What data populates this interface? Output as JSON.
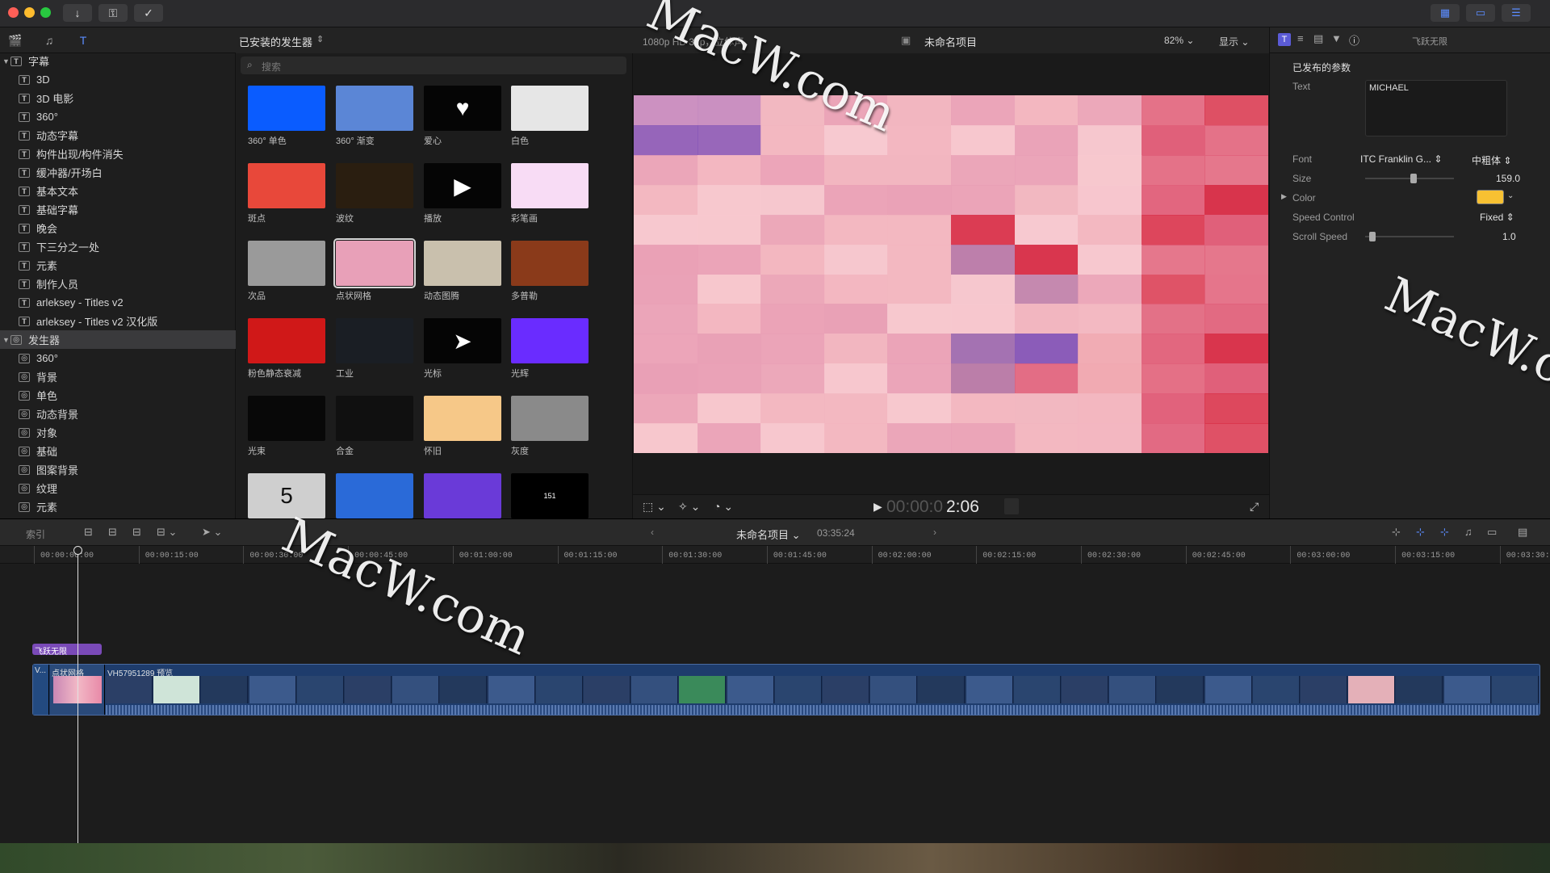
{
  "toolbar": {
    "left_buttons": [
      "download-icon",
      "key-icon",
      "check-circle-icon"
    ],
    "right_buttons": [
      "grid-view-icon",
      "filmstrip-icon",
      "sliders-icon"
    ]
  },
  "sidebar": {
    "sections": [
      {
        "label": "字幕",
        "items": [
          "3D",
          "3D 电影",
          "360°",
          "动态字幕",
          "构件出现/构件消失",
          "缓冲器/开场白",
          "基本文本",
          "基础字幕",
          "晚会",
          "下三分之一处",
          "元素",
          "制作人员",
          "arleksey - Titles v2",
          "arleksey - Titles v2 汉化版"
        ]
      },
      {
        "label": "发生器",
        "items": [
          "360°",
          "背景",
          "单色",
          "动态背景",
          "对象",
          "基础",
          "图案背景",
          "纹理",
          "元素"
        ]
      }
    ]
  },
  "browser": {
    "title": "已安装的发生器",
    "search_placeholder": "搜索",
    "tiles": [
      {
        "label": "360° 单色",
        "color": "#0a5cff"
      },
      {
        "label": "360° 渐变",
        "color": "#5b86d6"
      },
      {
        "label": "爱心",
        "color": "#050505",
        "glyph": "♥"
      },
      {
        "label": "白色",
        "color": "#e6e6e6"
      },
      {
        "label": "斑点",
        "color": "#e8483a"
      },
      {
        "label": "波纹",
        "color": "#2a1e10"
      },
      {
        "label": "播放",
        "color": "#050505",
        "glyph": "▶"
      },
      {
        "label": "彩笔画",
        "color": "#f8dcf5"
      },
      {
        "label": "次品",
        "color": "#9a9a9a"
      },
      {
        "label": "点状网格",
        "color": "#e8a0b8"
      },
      {
        "label": "动态图腾",
        "color": "#c9c0ad"
      },
      {
        "label": "多普勒",
        "color": "#8a3a1a"
      },
      {
        "label": "粉色静态衰减",
        "color": "#d01818"
      },
      {
        "label": "工业",
        "color": "#1a1e24"
      },
      {
        "label": "光标",
        "color": "#050505",
        "glyph": "➤"
      },
      {
        "label": "光辉",
        "color": "#6a2cff"
      },
      {
        "label": "光束",
        "color": "#080808"
      },
      {
        "label": "合金",
        "color": "#101010"
      },
      {
        "label": "怀旧",
        "color": "#f6c888"
      },
      {
        "label": "灰度",
        "color": "#8a8a8a"
      },
      {
        "label": "",
        "color": "#cfcfcf",
        "glyph": "5"
      },
      {
        "label": "",
        "color": "#2a6ad8"
      },
      {
        "label": "",
        "color": "#6a3ad8"
      },
      {
        "label": "",
        "color": "#000000",
        "glyph": "151"
      }
    ]
  },
  "viewer": {
    "format": "1080p HD 30p，立体声",
    "project": "未命名项目",
    "zoom": "82%",
    "display": "显示",
    "timecode_dim": "00:00:0",
    "timecode_bright": "2:06"
  },
  "inspector": {
    "title": "飞跃无限",
    "section": "已发布的参数",
    "text_label": "Text",
    "text_value": "MICHAEL",
    "font_label": "Font",
    "font_value": "ITC Franklin G...",
    "font_weight": "中粗体",
    "size_label": "Size",
    "size_value": "159.0",
    "size_level": 0.55,
    "color_label": "Color",
    "color_value": "#f7c132",
    "speed_label": "Speed Control",
    "speed_value": "Fixed",
    "scroll_label": "Scroll Speed",
    "scroll_value": "1.0",
    "scroll_level": 0.05
  },
  "timeline": {
    "index_label": "索引",
    "project": "未命名项目",
    "duration": "03:35:24",
    "ruler": [
      "00:00:00:00",
      "00:00:15:00",
      "00:00:30:00",
      "00:00:45:00",
      "00:01:00:00",
      "00:01:15:00",
      "00:01:30:00",
      "00:01:45:00",
      "00:02:00:00",
      "00:02:15:00",
      "00:02:30:00",
      "00:02:45:00",
      "00:03:00:00",
      "00:03:15:00",
      "00:03:30:00"
    ],
    "title_clip": "飞跃无限",
    "clip_a": "V...",
    "clip_b": "点状网格",
    "clip_c": "VH57951289 预览"
  },
  "watermarks": [
    "MacW.com",
    "MacW.com",
    "MacW.c"
  ]
}
